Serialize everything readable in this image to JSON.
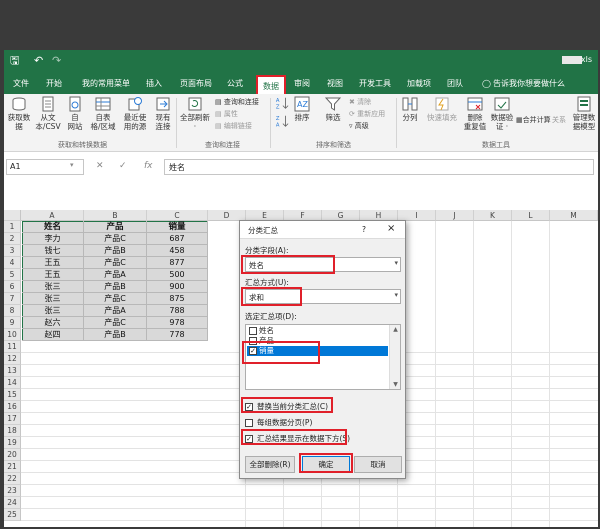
{
  "titlebar": {
    "filename": "xls",
    "undo": "↶",
    "redo": "↷",
    "save": "🖫"
  },
  "tabs": [
    {
      "label": "文件"
    },
    {
      "label": "开始"
    },
    {
      "label": "我的常用菜单"
    },
    {
      "label": "插入"
    },
    {
      "label": "页面布局"
    },
    {
      "label": "公式"
    },
    {
      "label": "数据"
    },
    {
      "label": "审阅"
    },
    {
      "label": "视图"
    },
    {
      "label": "开发工具"
    },
    {
      "label": "加载项"
    },
    {
      "label": "团队"
    },
    {
      "label": "告诉我你想要做什么"
    }
  ],
  "ribbon": {
    "get_data": {
      "b1": {
        "top": "获取数",
        "bottom": "据"
      },
      "b2": {
        "top": "从文",
        "bottom": "本/CSV"
      },
      "b3": {
        "top": "自",
        "bottom": "网站"
      },
      "b4": {
        "top": "自表",
        "bottom": "格/区域"
      },
      "b5": {
        "top": "最近使",
        "bottom": "用的源"
      },
      "b6": {
        "top": "现有",
        "bottom": "连接"
      },
      "group": "获取和转换数据"
    },
    "queries": {
      "refresh": {
        "top": "全部刷新",
        "bottom": "·"
      },
      "s1": "查询和连接",
      "s2": "属性",
      "s3": "编辑链接",
      "group": "查询和连接"
    },
    "sort": {
      "sort": "排序",
      "filter": "筛选",
      "s1": "清除",
      "s2": "重新应用",
      "s3": "高级",
      "group": "排序和筛选"
    },
    "tools": {
      "t1": "分列",
      "t2": "快速填充",
      "t3": {
        "top": "删除",
        "bottom": "重复值"
      },
      "t4": {
        "top": "数据验",
        "bottom": "证 ·"
      },
      "t5": "合并计算",
      "t6": "关系",
      "t7": {
        "top": "管理数",
        "bottom": "据模型"
      },
      "group": "数据工具"
    }
  },
  "formula_bar": {
    "name_box": "A1",
    "cancel": "✕",
    "enter": "✓",
    "fx": "fx",
    "content": "姓名"
  },
  "grid": {
    "columns": [
      "A",
      "B",
      "C",
      "D",
      "E",
      "F",
      "G",
      "H",
      "I",
      "J",
      "K",
      "L",
      "M"
    ],
    "rows": [
      "1",
      "2",
      "3",
      "4",
      "5",
      "6",
      "7",
      "8",
      "9",
      "10",
      "11",
      "12",
      "13",
      "14",
      "15",
      "16",
      "17",
      "18",
      "19",
      "20",
      "21",
      "22",
      "23",
      "24",
      "25"
    ],
    "header": [
      "姓名",
      "产品",
      "销量"
    ],
    "data": [
      [
        "李力",
        "产品C",
        "687"
      ],
      [
        "钱七",
        "产品B",
        "458"
      ],
      [
        "王五",
        "产品C",
        "877"
      ],
      [
        "王五",
        "产品A",
        "500"
      ],
      [
        "张三",
        "产品B",
        "900"
      ],
      [
        "张三",
        "产品C",
        "875"
      ],
      [
        "张三",
        "产品A",
        "788"
      ],
      [
        "赵六",
        "产品C",
        "978"
      ],
      [
        "赵四",
        "产品B",
        "778"
      ]
    ]
  },
  "dialog": {
    "title": "分类汇总",
    "help": "?",
    "close": "×",
    "field_label": "分类字段(A):",
    "field_value": "姓名",
    "method_label": "汇总方式(U):",
    "method_value": "求和",
    "items_label": "选定汇总项(D):",
    "items": [
      "姓名",
      "产品",
      "销量"
    ],
    "items_checked": [
      false,
      false,
      true
    ],
    "opt_replace": "替换当前分类汇总(C)",
    "opt_pagebreak": "每组数据分页(P)",
    "opt_summary_below": "汇总结果显示在数据下方(S)",
    "btn_remove_all": "全部删除(R)",
    "btn_ok": "确定",
    "btn_cancel": "取消",
    "checkmark": "✓",
    "arrow": "▾",
    "scroll_up": "▲",
    "scroll_down": "▼"
  },
  "colors": {
    "excel_green": "#217346",
    "highlight_red": "#e0202a",
    "selection_blue": "#0078d7"
  }
}
